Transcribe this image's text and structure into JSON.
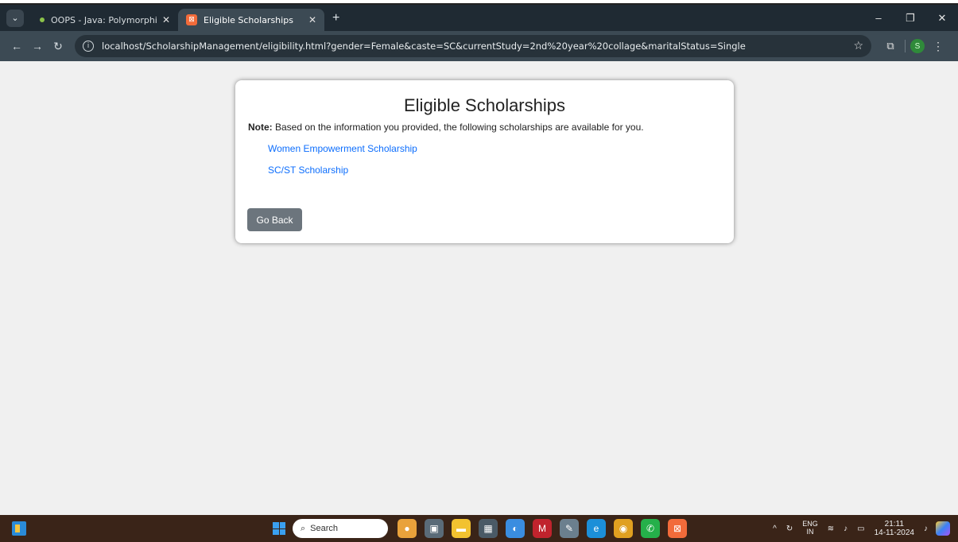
{
  "browser": {
    "tabs": [
      {
        "title": "OOPS - Java: Polymorphism - G",
        "active": false
      },
      {
        "title": "Eligible Scholarships",
        "active": true
      }
    ],
    "new_tab_symbol": "+",
    "url": "localhost/ScholarshipManagement/eligibility.html?gender=Female&caste=SC&currentStudy=2nd%20year%20collage&maritalStatus=Single",
    "profile_initial": "S"
  },
  "page": {
    "heading": "Eligible Scholarships",
    "note_label": "Note:",
    "note_text": " Based on the information you provided, the following scholarships are available for you.",
    "scholarships": [
      "Women Empowerment Scholarship",
      "SC/ST Scholarship"
    ],
    "back_button": "Go Back"
  },
  "taskbar": {
    "search_placeholder": "Search",
    "lang_top": "ENG",
    "lang_bottom": "IN",
    "time": "21:11",
    "date": "14-11-2024"
  },
  "colors": {
    "link": "#0d6efd",
    "button": "#6c757d",
    "tab_strip": "#1f2a33",
    "toolbar": "#3c4a54"
  }
}
